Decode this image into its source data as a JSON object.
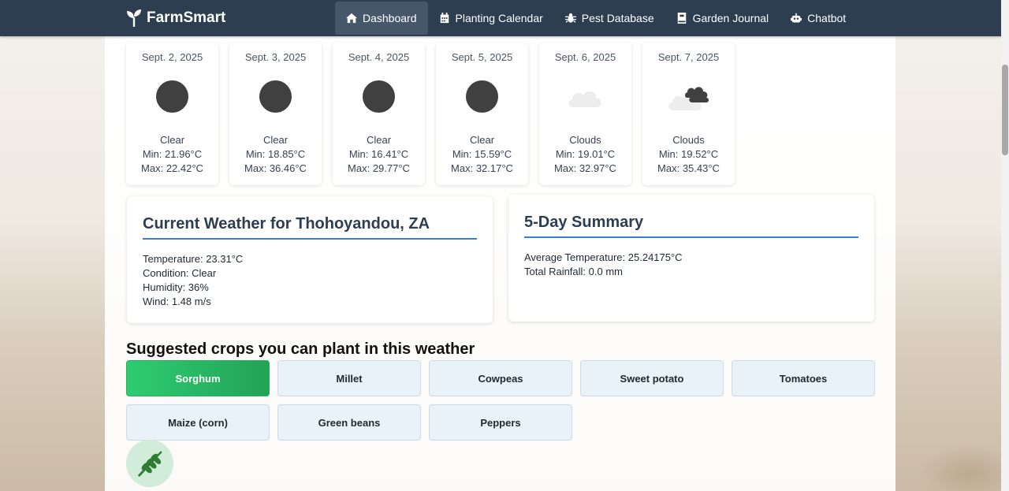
{
  "nav": {
    "brand": "FarmSmart",
    "items": [
      {
        "label": "Dashboard",
        "icon": "home-icon",
        "active": true
      },
      {
        "label": "Planting Calendar",
        "icon": "calendar-icon"
      },
      {
        "label": "Pest Database",
        "icon": "bug-icon"
      },
      {
        "label": "Garden Journal",
        "icon": "journal-icon"
      },
      {
        "label": "Chatbot",
        "icon": "robot-icon"
      }
    ]
  },
  "forecast": [
    {
      "date": "Sept. 2, 2025",
      "condition": "Clear",
      "min": "Min: 21.96°C",
      "max": "Max: 22.42°C",
      "icon": "clear-icon"
    },
    {
      "date": "Sept. 3, 2025",
      "condition": "Clear",
      "min": "Min: 18.85°C",
      "max": "Max: 36.46°C",
      "icon": "clear-icon"
    },
    {
      "date": "Sept. 4, 2025",
      "condition": "Clear",
      "min": "Min: 16.41°C",
      "max": "Max: 29.77°C",
      "icon": "clear-icon"
    },
    {
      "date": "Sept. 5, 2025",
      "condition": "Clear",
      "min": "Min: 15.59°C",
      "max": "Max: 32.17°C",
      "icon": "clear-icon"
    },
    {
      "date": "Sept. 6, 2025",
      "condition": "Clouds",
      "min": "Min: 19.01°C",
      "max": "Max: 32.97°C",
      "icon": "cloud-icon"
    },
    {
      "date": "Sept. 7, 2025",
      "condition": "Clouds",
      "min": "Min: 19.52°C",
      "max": "Max: 35.43°C",
      "icon": "broken-clouds-icon"
    }
  ],
  "current": {
    "title": "Current Weather for Thohoyandou, ZA",
    "temperature": "Temperature: 23.31°C",
    "condition": "Condition: Clear",
    "humidity": "Humidity: 36%",
    "wind": "Wind: 1.48 m/s"
  },
  "summary": {
    "title": "5-Day Summary",
    "avg_temp": "Average Temperature: 25.24175°C",
    "rainfall": "Total Rainfall: 0.0 mm"
  },
  "crops": {
    "title": "Suggested crops you can plant in this weather",
    "items": [
      "Sorghum",
      "Millet",
      "Cowpeas",
      "Sweet potato",
      "Tomatoes",
      "Maize (corn)",
      "Green beans",
      "Peppers"
    ],
    "selected": "Sorghum"
  },
  "colors": {
    "nav_bg": "#2c3e50",
    "accent_green": "#27ae60",
    "underline_blue": "#3b82c4"
  }
}
